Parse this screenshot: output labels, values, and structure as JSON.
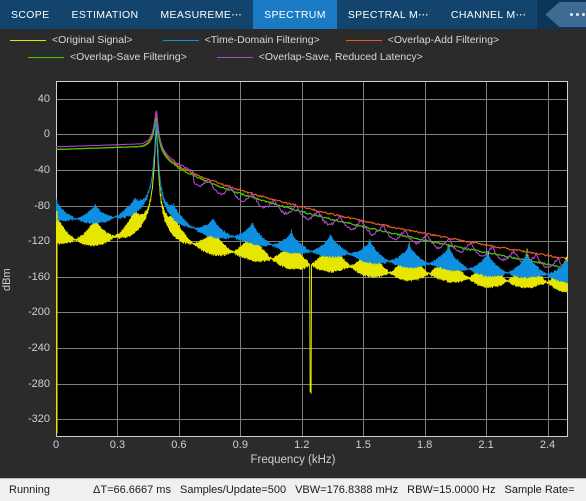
{
  "toolbar": {
    "tabs": [
      {
        "label": "SCOPE",
        "active": false
      },
      {
        "label": "ESTIMATION",
        "active": false
      },
      {
        "label": "MEASUREME⋯",
        "active": false
      },
      {
        "label": "SPECTRUM",
        "active": true
      },
      {
        "label": "SPECTRAL M⋯",
        "active": false
      },
      {
        "label": "CHANNEL M⋯",
        "active": false
      }
    ],
    "overflow_label": "⋯",
    "active_tab_color": "#1a7ac4",
    "bar_color": "#12446e"
  },
  "status": {
    "state": "Running",
    "delta_t": "ΔT=66.6667 ms",
    "samples_per_update": "Samples/Update=500",
    "vbw": "VBW=176.8388 mHz",
    "rbw": "RBW=15.0000 Hz",
    "sample_rate": "Sample Rate="
  },
  "chart_data": {
    "type": "line",
    "title": "",
    "xlabel": "Frequency (kHz)",
    "ylabel": "dBm",
    "xlim": [
      0,
      2.5
    ],
    "ylim": [
      -340,
      60
    ],
    "xticks": [
      0,
      0.3,
      0.6,
      0.9,
      1.2,
      1.5,
      1.8,
      2.1,
      2.4
    ],
    "xticklabels": [
      "0",
      "0.3",
      "0.6",
      "0.9",
      "1.2",
      "1.5",
      "1.8",
      "2.1",
      "2.4"
    ],
    "yticks": [
      40,
      0,
      -40,
      -80,
      -120,
      -160,
      -200,
      -240,
      -280,
      -320
    ],
    "yticklabels": [
      "40",
      "0",
      "-40",
      "-80",
      "-120",
      "-160",
      "-200",
      "-240",
      "-280",
      "-320"
    ],
    "grid": true,
    "background": "#000000",
    "gridcolor": "#808080",
    "legend_position": "above-plot",
    "series": [
      {
        "name": "<Original Signal>",
        "color": "#e6e600",
        "description": "Noisy broadband spectrum with sidelobe ripple, peak ~25 dBm at 0.49 kHz, deep null spike to -295 dBm at 1.24 kHz",
        "peak_x": 0.49,
        "peak_y": 25,
        "baseline_y": -85,
        "floor_y": -130
      },
      {
        "name": "<Time-Domain Filtering>",
        "color": "#0f8fe0",
        "description": "Filtered trace, smooth skirt starting at -72 dBm, peak ~25 dBm at 0.49 kHz, decaying to -135 dBm",
        "peak_x": 0.49,
        "peak_y": 25,
        "baseline_y": -72,
        "floor_y": -135
      },
      {
        "name": "<Overlap-Add Filtering>",
        "color": "#e35c1c",
        "description": "Overlap-add result, overlaps with overlap-save traces",
        "peak_x": 0.49,
        "peak_y": 27,
        "baseline_y": -17,
        "floor_y": -140
      },
      {
        "name": "<Overlap-Save Filtering>",
        "color": "#3ecc00",
        "description": "Overlap-save result, starting at -17 dBm, peak ~20 dBm at 0.49 kHz",
        "peak_x": 0.49,
        "peak_y": 20,
        "baseline_y": -17,
        "floor_y": -150
      },
      {
        "name": "<Overlap-Save,  Reduced Latency>",
        "color": "#b046c8",
        "description": "Reduced latency overlap-save, starting at -14 dBm, peak ~27 dBm at 0.49 kHz",
        "peak_x": 0.49,
        "peak_y": 27,
        "baseline_y": -14,
        "floor_y": -140
      }
    ]
  }
}
